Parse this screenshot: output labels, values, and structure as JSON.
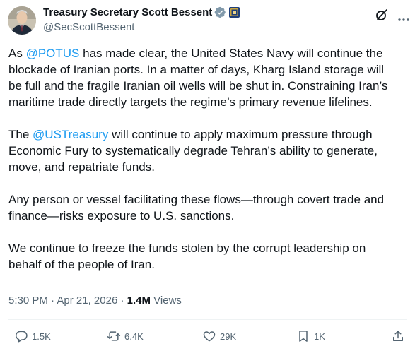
{
  "author": {
    "display_name": "Treasury Secretary Scott Bessent",
    "handle": "@SecScottBessent",
    "verified_badge_icon": "verified-badge-icon",
    "affiliation_badge_icon": "treasury-seal-icon"
  },
  "header_actions": {
    "grok_icon": "grok-icon",
    "more_icon": "more-icon"
  },
  "tweet": {
    "p1": {
      "l1_a": "As ",
      "l1_mention": "@POTUS",
      "l1_b": " has made clear, the United States Navy will continue the",
      "l2": "blockade of Iranian ports.  In a matter of days, Kharg Island storage will",
      "l3": "be full and the fragile Iranian oil wells will be shut in. Constraining Iran’s",
      "l4": "maritime trade directly targets the regime’s primary revenue lifelines."
    },
    "p2": {
      "l1_a": "The ",
      "l1_mention": "@USTreasury",
      "l1_b": " will continue to apply maximum pressure through",
      "l2": "Economic Fury to systematically degrade Tehran’s ability to generate,",
      "l3": "move, and repatriate funds."
    },
    "p3": {
      "l1": "Any person or vessel facilitating these flows—through covert trade and",
      "l2": "finance—risks exposure to U.S. sanctions."
    },
    "p4": {
      "l1": "We continue to freeze the funds stolen by the corrupt leadership on",
      "l2": "behalf of the people of Iran."
    }
  },
  "meta": {
    "time": "5:30 PM",
    "separator": " · ",
    "date": "Apr 21, 2026",
    "separator2": " · ",
    "views_count": "1.4M",
    "views_label": " Views"
  },
  "actions": {
    "reply_count": "1.5K",
    "repost_count": "6.4K",
    "like_count": "29K",
    "bookmark_count": "1K"
  },
  "colors": {
    "text": "#0f1419",
    "secondary": "#536471",
    "link": "#1d9bf0",
    "verified_gold": "#829aab"
  }
}
